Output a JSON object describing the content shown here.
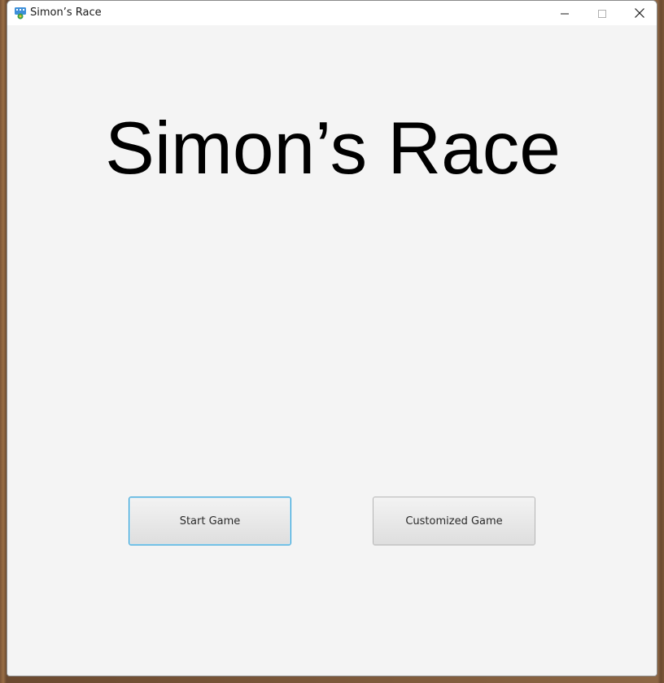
{
  "window": {
    "title": "Simon’s Race",
    "icon": "game-app-icon",
    "controls": {
      "minimize_icon": "minimize-icon",
      "maximize_icon": "maximize-icon",
      "close_icon": "close-icon"
    }
  },
  "main": {
    "heading": "Simon’s Race",
    "buttons": {
      "start": "Start Game",
      "customized": "Customized Game"
    },
    "focused_button": "start"
  },
  "colors": {
    "background": "#f4f4f4",
    "focus_border": "#2a9fd6",
    "heading_text": "#000000"
  }
}
